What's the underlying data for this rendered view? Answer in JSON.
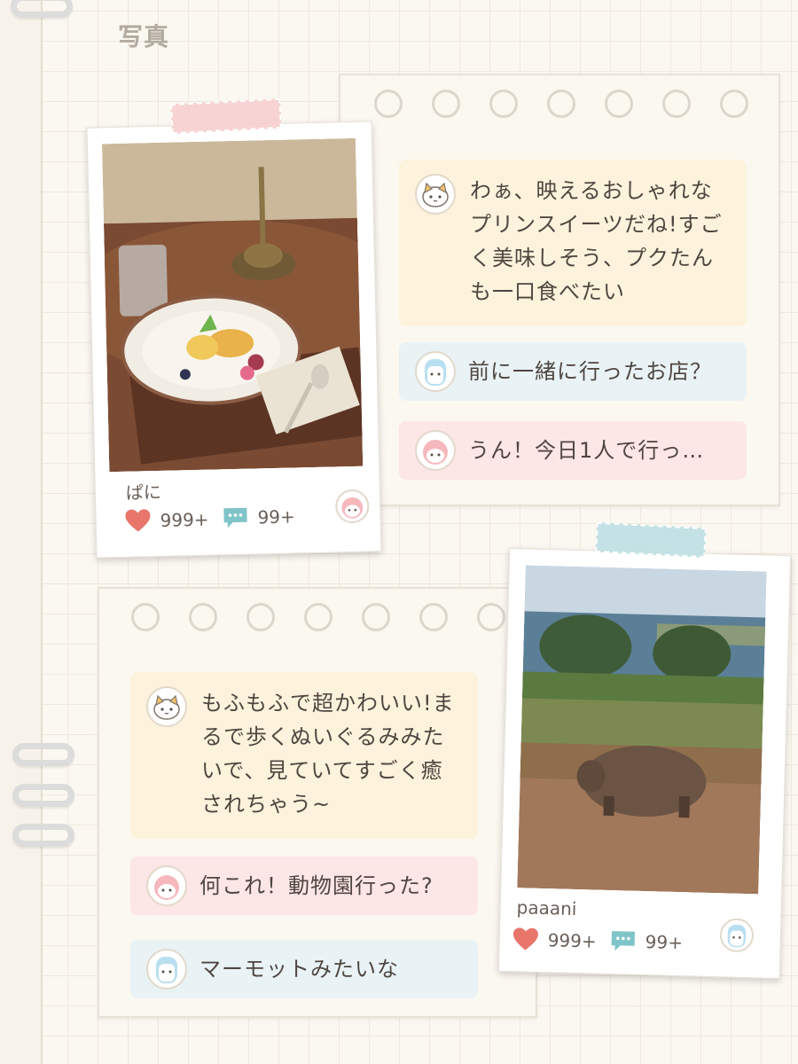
{
  "page": {
    "title": "写真"
  },
  "post1": {
    "username": "ぱに",
    "likes": "999+",
    "comments": "99+",
    "messages": [
      {
        "text": "わぁ、映えるおしゃれなプリンスイーツだね!すごく美味しそう、プクたんも一口食べたい",
        "color": "yellow",
        "avatar": "cat-avatar-icon"
      },
      {
        "text": "前に一緒に行ったお店？",
        "color": "blue",
        "avatar": "blue-character-avatar-icon"
      },
      {
        "text": "うん！今日1人で行っ…",
        "color": "pink",
        "avatar": "pink-character-avatar-icon"
      }
    ]
  },
  "post2": {
    "username": "paaani",
    "likes": "999+",
    "comments": "99+",
    "messages": [
      {
        "text": "もふもふで超かわいい!まるで歩くぬいぐるみみたいで、見ていてすごく癒されちゃう~",
        "color": "yellow",
        "avatar": "cat-avatar-icon"
      },
      {
        "text": "何これ！動物園行った?",
        "color": "pink",
        "avatar": "pink-character-avatar-icon"
      },
      {
        "text": "マーモットみたいな",
        "color": "blue",
        "avatar": "blue-character-avatar-icon"
      }
    ]
  },
  "colors": {
    "bubble_yellow": "#fdf2dc",
    "bubble_blue": "#e9f3f6",
    "bubble_pink": "#fde6e6",
    "heart": "#e8766b",
    "comment_icon": "#7fc4c9",
    "tape_pink": "#f7cfd0",
    "tape_blue": "#bfe0e4"
  }
}
